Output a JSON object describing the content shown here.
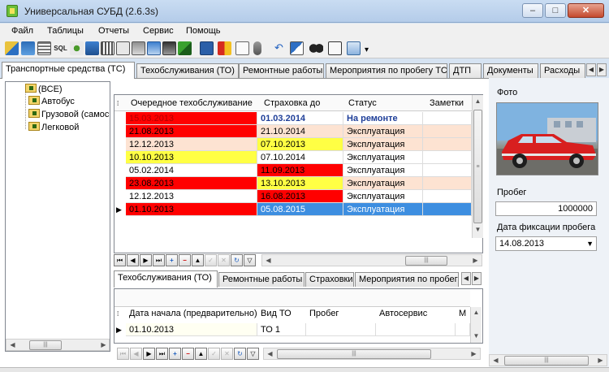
{
  "window": {
    "title": "Универсальная СУБД (2.6.3s)",
    "minimize": "–",
    "maximize": "□",
    "close": "✕"
  },
  "menu": [
    "Файл",
    "Таблицы",
    "Отчеты",
    "Сервис",
    "Помощь"
  ],
  "toolbar": {
    "sql_label": "SQL"
  },
  "main_tabs": [
    "Транспортные средства (ТС)",
    "Техобслуживания (ТО)",
    "Ремонтные работы",
    "Мероприятия по пробегу ТС",
    "ДТП",
    "Документы",
    "Расходы"
  ],
  "tree": {
    "root": "(ВСЕ)",
    "children": [
      "Автобус",
      "Грузовой (самосвал)",
      "Легковой"
    ]
  },
  "grid": {
    "columns": [
      "Очередное техобслуживание",
      "Страховка до",
      "Статус",
      "Заметки"
    ],
    "rows": [
      {
        "to": "15.03.2013",
        "ins": "01.03.2014",
        "status": "На ремонте"
      },
      {
        "to": "21.08.2013",
        "ins": "21.10.2014",
        "status": "Эксплуатация"
      },
      {
        "to": "12.12.2013",
        "ins": "07.10.2013",
        "status": "Эксплуатация"
      },
      {
        "to": "10.10.2013",
        "ins": "07.10.2014",
        "status": "Эксплуатация"
      },
      {
        "to": "05.02.2014",
        "ins": "11.09.2013",
        "status": "Эксплуатация"
      },
      {
        "to": "23.08.2013",
        "ins": "13.10.2013",
        "status": "Эксплуатация"
      },
      {
        "to": "12.12.2013",
        "ins": "16.08.2013",
        "status": "Эксплуатация"
      },
      {
        "to": "01.10.2013",
        "ins": "05.08.2015",
        "status": "Эксплуатация"
      }
    ]
  },
  "sub_tabs": [
    "Техобслуживания (ТО)",
    "Ремонтные работы",
    "Страховки",
    "Мероприятия по пробегу"
  ],
  "sub_grid": {
    "columns": [
      "Дата начала (предварительно)",
      "Вид ТО",
      "Пробег",
      "Автосервис",
      "М"
    ],
    "rows": [
      {
        "date": "01.10.2013",
        "kind": "ТО 1"
      }
    ]
  },
  "right_panel": {
    "photo_label": "Фото",
    "mileage_label": "Пробег",
    "mileage_value": "1000000",
    "fix_date_label": "Дата фиксации пробега",
    "fix_date_value": "14.08.2013"
  },
  "colors": {
    "red": "#ff0000",
    "salmon": "#fde3d2",
    "yellow": "#ffff44",
    "selected": "#3d8ee0",
    "status_blue": "#1f3f99"
  }
}
